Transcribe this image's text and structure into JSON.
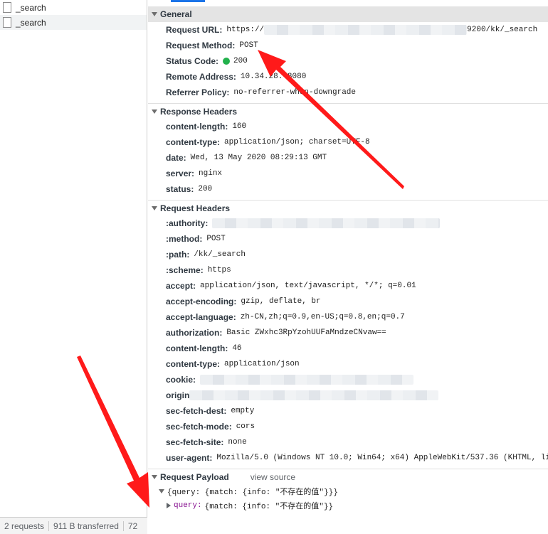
{
  "requests": [
    {
      "name": "_search"
    },
    {
      "name": "_search"
    }
  ],
  "statusbar": {
    "requests": "2 requests",
    "transferred": "911 B transferred",
    "extra": "72"
  },
  "general": {
    "title": "General",
    "request_url_label": "Request URL:",
    "request_url_prefix": "https://",
    "request_url_suffix": "9200/kk/_search",
    "request_method_label": "Request Method:",
    "request_method": "POST",
    "status_code_label": "Status Code:",
    "status_code": "200",
    "remote_address_label": "Remote Address:",
    "remote_address": "10.34.28.  8080",
    "referrer_policy_label": "Referrer Policy:",
    "referrer_policy": "no-referrer-when-downgrade"
  },
  "response_headers": {
    "title": "Response Headers",
    "items": [
      {
        "key": "content-length:",
        "value": "160"
      },
      {
        "key": "content-type:",
        "value": "application/json; charset=UTF-8"
      },
      {
        "key": "date:",
        "value": "Wed, 13 May 2020 08:29:13 GMT"
      },
      {
        "key": "server:",
        "value": "nginx"
      },
      {
        "key": "status:",
        "value": "200"
      }
    ]
  },
  "request_headers": {
    "title": "Request Headers",
    "authority_label": ":authority:",
    "method_label": ":method:",
    "method": "POST",
    "path_label": ":path:",
    "path": "/kk/_search",
    "scheme_label": ":scheme:",
    "scheme": "https",
    "accept_label": "accept:",
    "accept": "application/json, text/javascript, */*; q=0.01",
    "accept_encoding_label": "accept-encoding:",
    "accept_encoding": "gzip, deflate, br",
    "accept_language_label": "accept-language:",
    "accept_language": "zh-CN,zh;q=0.9,en-US;q=0.8,en;q=0.7",
    "authorization_label": "authorization:",
    "authorization": "Basic ZWxhc3RpYzohUUFaMndzeCNvaw==",
    "content_length_label": "content-length:",
    "content_length": "46",
    "content_type_label": "content-type:",
    "content_type": "application/json",
    "cookie_label": "cookie:",
    "origin_label": "origin",
    "sec_fetch_dest_label": "sec-fetch-dest:",
    "sec_fetch_dest": "empty",
    "sec_fetch_mode_label": "sec-fetch-mode:",
    "sec_fetch_mode": "cors",
    "sec_fetch_site_label": "sec-fetch-site:",
    "sec_fetch_site": "none",
    "user_agent_label": "user-agent:",
    "user_agent": "Mozilla/5.0 (Windows NT 10.0; Win64; x64) AppleWebKit/537.36 (KHTML, li"
  },
  "payload": {
    "title": "Request Payload",
    "view_source": "view source",
    "summary": "{query: {match: {info: \"不存在的值\"}}}",
    "query_key": "query:",
    "query_value": "{match: {info: \"不存在的值\"}}"
  },
  "colors": {
    "status_dot": "#22b14c",
    "arrow": "#ff1a1a",
    "tab_accent": "#1a73e8"
  }
}
